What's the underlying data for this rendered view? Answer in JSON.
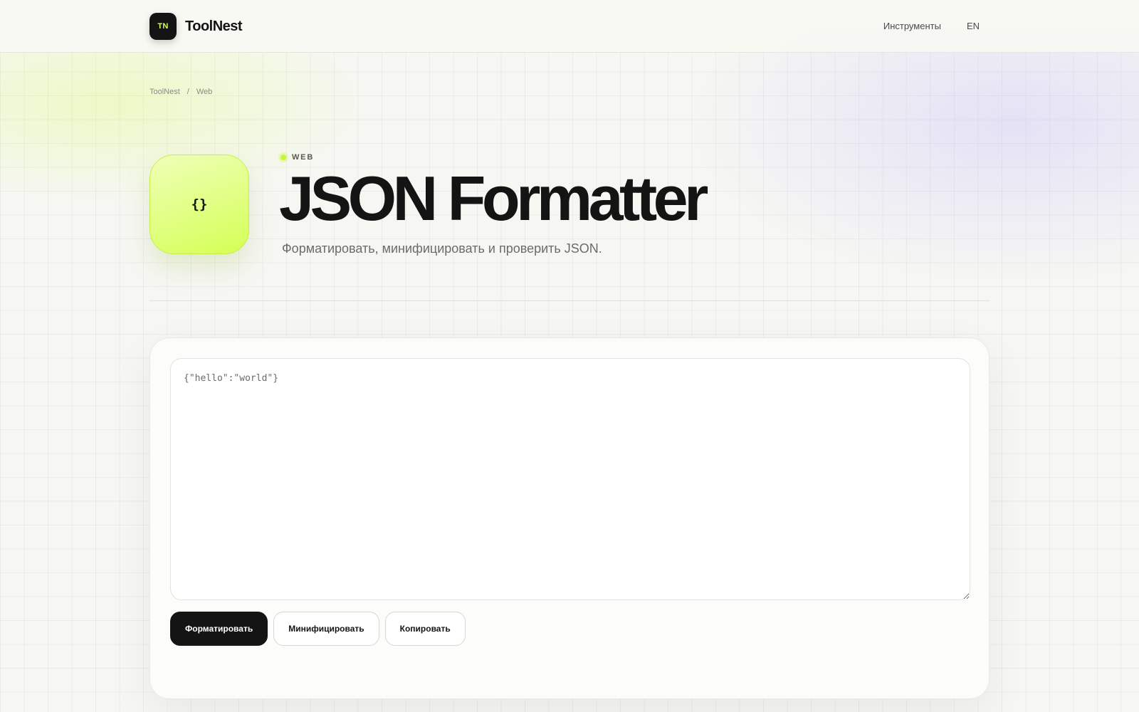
{
  "header": {
    "logo_badge": "TN",
    "brand": "ToolNest",
    "nav": [
      {
        "label": "Инструменты"
      },
      {
        "label": "EN"
      }
    ]
  },
  "breadcrumb": {
    "items": [
      "ToolNest",
      "Web"
    ],
    "separator": "/"
  },
  "tool": {
    "icon_glyph": "{}",
    "icon_name": "braces-icon",
    "category": "WEB",
    "title": "JSON Formatter",
    "subtitle": "Форматировать, минифицировать и проверить JSON."
  },
  "editor": {
    "value": "{\"hello\":\"world\"}"
  },
  "actions": {
    "format_label": "Форматировать",
    "minify_label": "Минифицировать",
    "copy_label": "Копировать"
  },
  "colors": {
    "accent": "#d4ff55",
    "dark": "#141414",
    "background": "#f6f7f3"
  }
}
